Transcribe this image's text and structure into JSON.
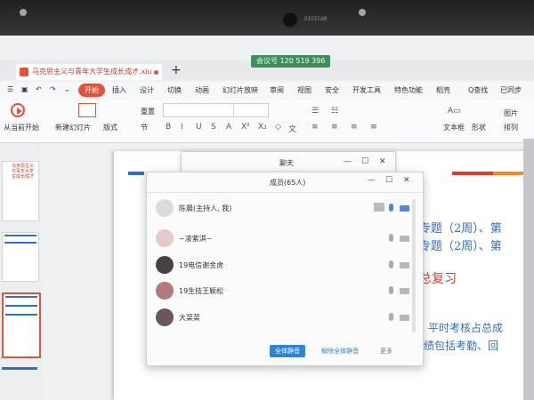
{
  "bezel": {
    "camera_label": "DIGICAM"
  },
  "meeting": {
    "label": "会议号 120 519 396"
  },
  "tabs": {
    "doc_title": "马克思主义与青年大学生成长成才.xiu",
    "new_tab": "+"
  },
  "ribbon_tabs": {
    "start": "开始",
    "items": [
      "插入",
      "设计",
      "切换",
      "动画",
      "幻灯片放映",
      "审阅",
      "视图",
      "安全",
      "开发工具",
      "特色功能",
      "稻壳"
    ],
    "search": "Q查找",
    "sync": "已同步"
  },
  "ribbon": {
    "play_from_current": "从当前开始",
    "new_slide": "新建幻灯片",
    "layout": "版式",
    "section": "节",
    "reset": "重置",
    "textbox": "文本框",
    "shape": "形状",
    "arrange": "排列",
    "picture": "图片",
    "format_glyphs": [
      "B",
      "I",
      "U",
      "S",
      "A",
      "X²",
      "X₂",
      "◇",
      "文"
    ]
  },
  "thumbs": [
    {
      "text": "马克思主义与青年大学生成长成才"
    },
    {
      "text": ""
    },
    {
      "text": ""
    }
  ],
  "slide": {
    "lines": [
      "专题（2周）、第",
      "专题（2周）、第",
      "总复习",
      "平时考核占总成",
      "成绩包括考勤、回"
    ]
  },
  "chat": {
    "title": "聊天"
  },
  "members_panel": {
    "title": "成员(65人)",
    "rows": [
      {
        "name": "陈晨(主持人, 我)"
      },
      {
        "name": "~凌紫淇~"
      },
      {
        "name": "19电信谢金虎"
      },
      {
        "name": "19生技王颖松"
      },
      {
        "name": "大菜菜"
      }
    ],
    "mute_all": "全体静音",
    "unmute_all": "解除全体静音",
    "more": "更多"
  },
  "colors": {
    "accent_red": "#e0533a",
    "ribbon_bg": "#f6f7f9",
    "slide_red": "#d9412f",
    "slide_blue": "#2f6fc9",
    "slide_orange": "#f08a24",
    "button_blue": "#2d84d6"
  }
}
